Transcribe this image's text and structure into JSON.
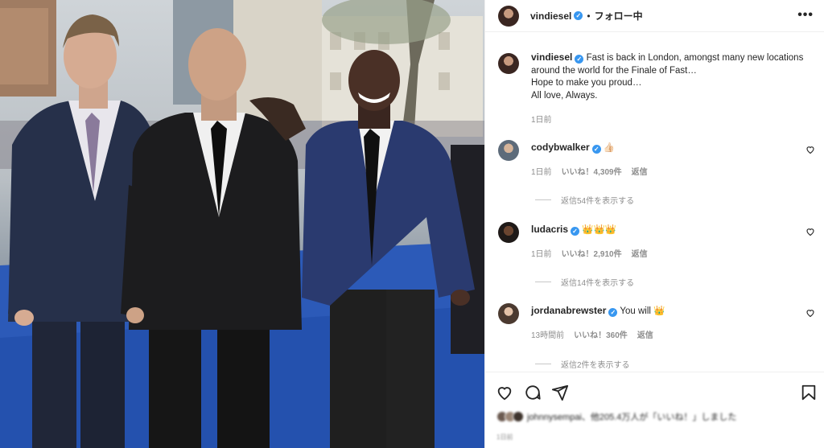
{
  "post": {
    "username": "vindiesel",
    "verified_mark": "✓",
    "separator": "•",
    "follow_status": "フォロー中",
    "more_icon": "more-horizontal-icon",
    "more_label": "•••"
  },
  "caption": {
    "username": "vindiesel",
    "lines": [
      "Fast is back in London, amongst many new locations",
      "around the world for the Finale of Fast…",
      "Hope to make you proud…",
      "All love, Always."
    ],
    "time": "1日前"
  },
  "comments": [
    {
      "username": "codybwalker",
      "text": "👍🏻",
      "time": "1日前",
      "likes": "いいね！4,309件",
      "reply": "返信",
      "view_replies": "返信54件を表示する"
    },
    {
      "username": "ludacris",
      "text": "👑👑👑",
      "time": "1日前",
      "likes": "いいね！2,910件",
      "reply": "返信",
      "view_replies": "返信14件を表示する"
    },
    {
      "username": "jordanabrewster",
      "text": "You will 👑",
      "time": "13時間前",
      "likes": "いいね！360件",
      "reply": "返信",
      "view_replies": "返信2件を表示する"
    }
  ],
  "footer": {
    "liked_by": "johnnysempai、他205.4万人が「いいね！」しました",
    "date": "1日前"
  },
  "colors": {
    "verified": "#3897f0",
    "secondary_text": "#8e8e8e",
    "primary_text": "#262626",
    "carpet_blue": "#2552b0"
  }
}
